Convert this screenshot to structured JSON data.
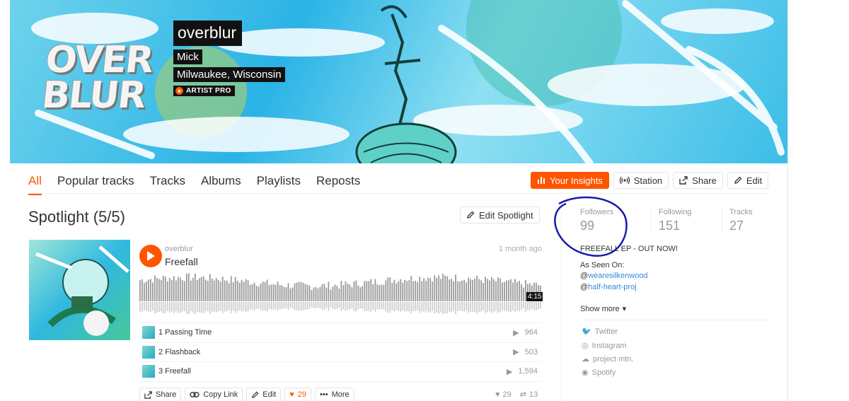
{
  "profile": {
    "username": "overblur",
    "name": "Mick",
    "location": "Milwaukee, Wisconsin",
    "badge": "ARTIST PRO",
    "logo_text": "OVER BLUR"
  },
  "tabs": [
    {
      "label": "All",
      "active": true
    },
    {
      "label": "Popular tracks"
    },
    {
      "label": "Tracks"
    },
    {
      "label": "Albums"
    },
    {
      "label": "Playlists"
    },
    {
      "label": "Reposts"
    }
  ],
  "actions": {
    "insights": "Your Insights",
    "station": "Station",
    "share": "Share",
    "edit": "Edit"
  },
  "spotlight": {
    "title": "Spotlight (5/5)",
    "edit_label": "Edit Spotlight",
    "track": {
      "user": "overblur",
      "title": "Freefall",
      "posted": "1 month ago",
      "duration": "4:15"
    },
    "tracklist": [
      {
        "label": "1  Passing Time",
        "plays": "964"
      },
      {
        "label": "2  Flashback",
        "plays": "503"
      },
      {
        "label": "3  Freefall",
        "plays": "1,594"
      }
    ],
    "buttons": {
      "share": "Share",
      "copy_link": "Copy Link",
      "edit": "Edit",
      "likes": "29",
      "more": "More"
    },
    "stats": {
      "likes": "29",
      "reposts": "13"
    }
  },
  "sidebar": {
    "followers_label": "Followers",
    "followers": "99",
    "following_label": "Following",
    "following": "151",
    "tracks_label": "Tracks",
    "tracks": "27",
    "bio_headline": "FREEFALL EP - OUT NOW!",
    "bio_seen": "As Seen On:",
    "bio_links": [
      {
        "at": "@",
        "handle": "wearesilkenwood"
      },
      {
        "at": "@",
        "handle": "half-heart-proj"
      }
    ],
    "show_more": "Show more",
    "socials": [
      {
        "label": "Twitter",
        "icon": "twitter-icon"
      },
      {
        "label": "Instagram",
        "icon": "instagram-icon"
      },
      {
        "label": "project mtn.",
        "icon": "soundcloud-icon"
      },
      {
        "label": "Spotify",
        "icon": "spotify-icon"
      }
    ]
  },
  "colors": {
    "accent": "#ff5500",
    "link": "#3388dd",
    "annotation": "#1a1aa8"
  }
}
